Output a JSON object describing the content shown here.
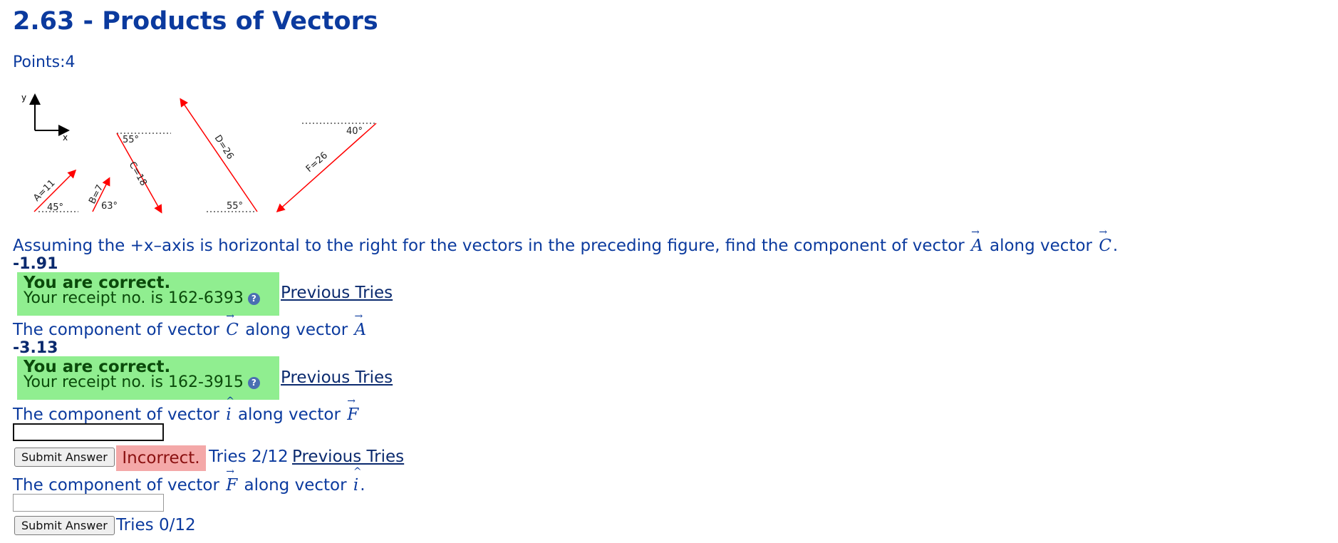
{
  "title": "2.63 - Products of Vectors",
  "points": "Points:4",
  "figure": {
    "axis_y": "y",
    "axis_x": "x",
    "vectors": {
      "A": "A=11",
      "B": "B=7",
      "C": "C=18",
      "D": "D=26",
      "F": "F=26"
    },
    "angles": {
      "A": "45°",
      "B": "63°",
      "C": "55°",
      "D": "55°",
      "F": "40°"
    },
    "colors": {
      "vector": "#ff0000",
      "axis": "#000000"
    }
  },
  "questions": [
    {
      "text_before": "Assuming the +x–axis is horizontal to the right for the vectors in the preceding figure, find the component of vector",
      "v1": "A",
      "text_mid": "along vector",
      "v2": "C",
      "text_after": ".",
      "answer": "-1.91",
      "feedback_title": "You are correct.",
      "receipt": "Your receipt no. is 162-6393",
      "previous_tries": "Previous Tries"
    },
    {
      "text_before": "The component of vector",
      "v1": "C",
      "text_mid": "along vector",
      "v2": "A",
      "text_after": "",
      "answer": "-3.13",
      "feedback_title": "You are correct.",
      "receipt": "Your receipt no. is 162-3915",
      "previous_tries": "Previous Tries"
    },
    {
      "text_before": "The component of vector",
      "v1": "i",
      "text_mid": "along vector",
      "v2": "F",
      "text_after": "",
      "input_value": "",
      "submit_label": "Submit Answer",
      "status": "Incorrect.",
      "tries": "Tries 2/12",
      "previous_tries": "Previous Tries"
    },
    {
      "text_before": "The component of vector",
      "v1": "F",
      "text_mid": "along vector",
      "v2": "i",
      "text_after": ".",
      "input_value": "",
      "submit_label": "Submit Answer",
      "tries": "Tries 0/12"
    }
  ]
}
